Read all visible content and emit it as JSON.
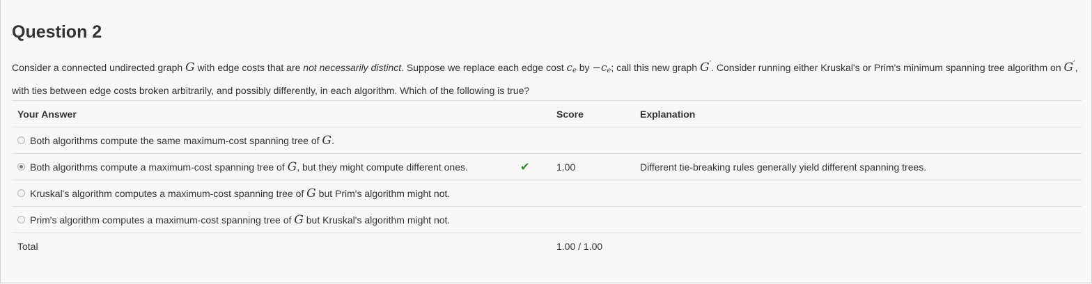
{
  "question": {
    "title": "Question 2",
    "prompt": {
      "p1": "Consider a connected undirected graph ",
      "g": "G",
      "p2": " with edge costs that are ",
      "emph": "not necessarily distinct",
      "p3": ". Suppose we replace each edge cost ",
      "ce": "c",
      "ce_sub": "e",
      "p4": " by ",
      "neg": "−c",
      "neg_sub": "e",
      "p5": "; call this new graph ",
      "gprime": "G",
      "prime": "′",
      "p6": ". Consider running either Kruskal's or Prim's minimum spanning tree algorithm on ",
      "p7": ", with ties between edge costs broken arbitrarily, and possibly differently, in each algorithm. Which of the following is true?"
    }
  },
  "table": {
    "headers": {
      "answer": "Your Answer",
      "score": "Score",
      "explanation": "Explanation"
    },
    "options": [
      {
        "pre": "Both algorithms compute the same maximum-cost spanning tree of ",
        "g": "G",
        "post": ".",
        "score": "",
        "explanation": ""
      },
      {
        "pre": "Both algorithms compute a maximum-cost spanning tree of ",
        "g": "G",
        "post": ", but they might compute different ones.",
        "score": "1.00",
        "explanation": "Different tie-breaking rules generally yield different spanning trees."
      },
      {
        "pre": "Kruskal's algorithm computes a maximum-cost spanning tree of ",
        "g": "G",
        "post": " but Prim's algorithm might not.",
        "score": "",
        "explanation": ""
      },
      {
        "pre": "Prim's algorithm computes a maximum-cost spanning tree of ",
        "g": "G",
        "post": " but Kruskal's algorithm might not.",
        "score": "",
        "explanation": ""
      }
    ],
    "selected_index": 1,
    "total_label": "Total",
    "total_score": "1.00 / 1.00"
  },
  "colors": {
    "check": "#2a8a2a",
    "border": "#dddddd",
    "background": "#f8f8f8"
  },
  "icons": {
    "correct": "checkmark-icon",
    "radio": "radio-icon"
  }
}
